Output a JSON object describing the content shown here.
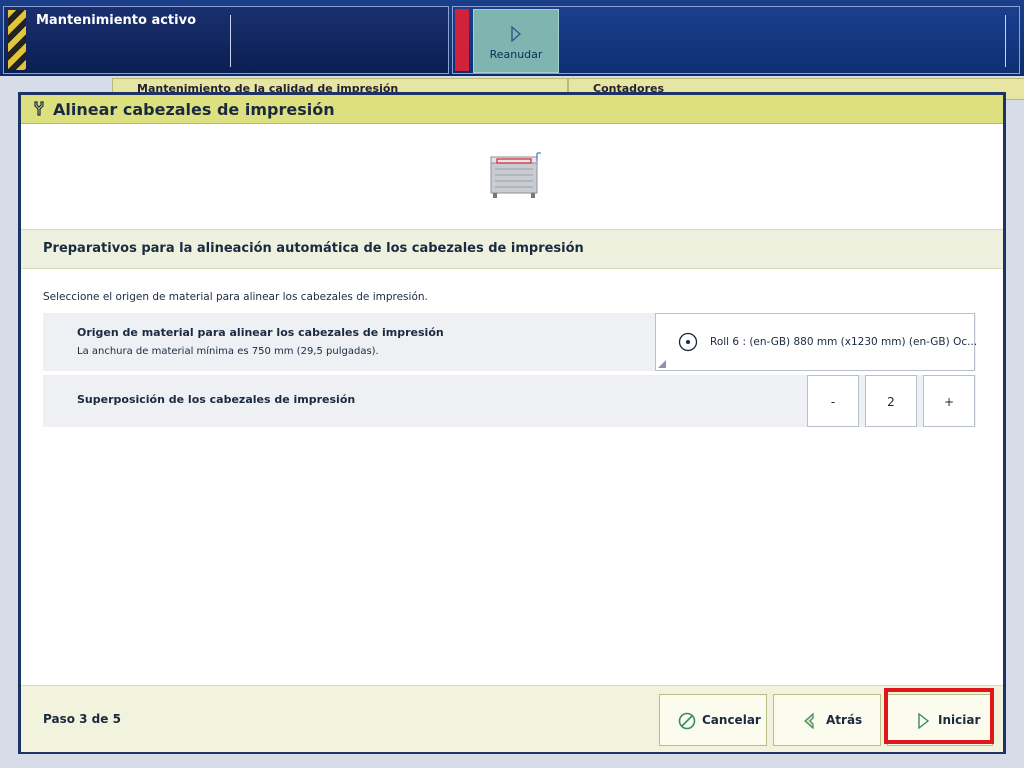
{
  "topbar": {
    "status_title": "Mantenimiento activo",
    "resume_label": "Reanudar"
  },
  "background": {
    "tab1": "Mantenimiento de la calidad de impresión",
    "tab2": "Contadores"
  },
  "dialog": {
    "title": "Alinear cabezales de impresión",
    "section_title": "Preparativos para la alineación automática de los cabezales de impresión",
    "instruction": "Seleccione el origen de material para alinear los cabezales de impresión.",
    "media_row": {
      "label": "Origen de material para alinear los cabezales de impresión",
      "sublabel": "La anchura de material mínima es 750 mm (29,5 pulgadas).",
      "value": "Roll 6 : (en-GB) 880 mm (x1230 mm) (en-GB) Oc..."
    },
    "overlap_row": {
      "label": "Superposición de los cabezales de impresión",
      "minus": "-",
      "value": "2",
      "plus": "+"
    },
    "footer": {
      "step": "Paso 3 de 5",
      "cancel": "Cancelar",
      "back": "Atrás",
      "start": "Iniciar"
    }
  },
  "colors": {
    "header": "#dde07e",
    "dialog_border": "#1d3366",
    "highlight": "#e0161b",
    "status_red": "#d0223a"
  }
}
